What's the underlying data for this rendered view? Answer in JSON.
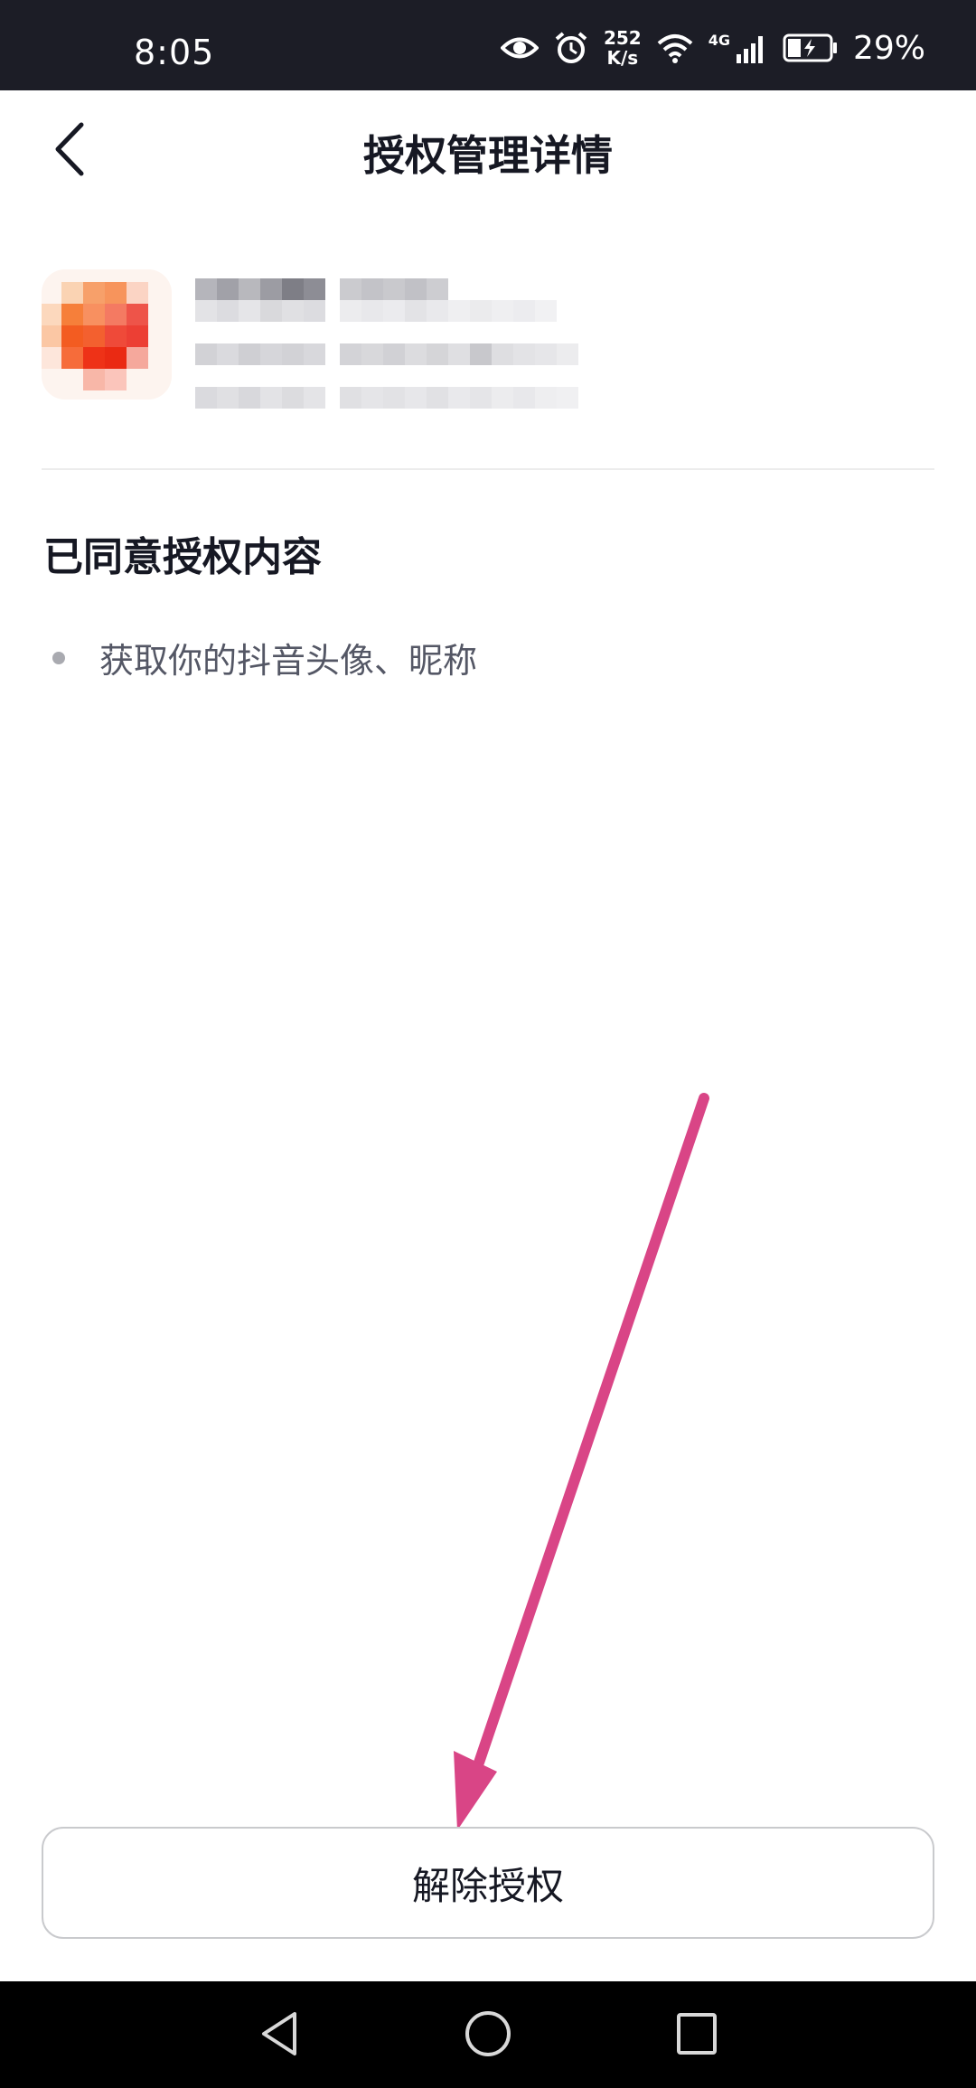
{
  "status_bar": {
    "time": "8:05",
    "speed_value": "252",
    "speed_unit": "K/s",
    "network": "4G",
    "battery_percent": "29%",
    "icons": [
      "eye-icon",
      "alarm-icon",
      "wifi-icon",
      "signal-icon",
      "battery-charging-icon"
    ]
  },
  "header": {
    "title": "授权管理详情",
    "back_icon": "chevron-left-icon"
  },
  "app_info": {
    "note": ""
  },
  "authorized": {
    "section_title": "已同意授权内容",
    "items": [
      "获取你的抖音头像、昵称"
    ]
  },
  "actions": {
    "revoke_label": "解除授权"
  },
  "annotation": {
    "arrow_color": "#d94586"
  },
  "nav_bar": {
    "icons": [
      "back-triangle-icon",
      "home-circle-icon",
      "recents-square-icon"
    ]
  },
  "colors": {
    "status_bar_bg": "#1c1d26",
    "text_primary": "#161823",
    "text_secondary": "#545765",
    "button_border": "#c9cacd"
  }
}
